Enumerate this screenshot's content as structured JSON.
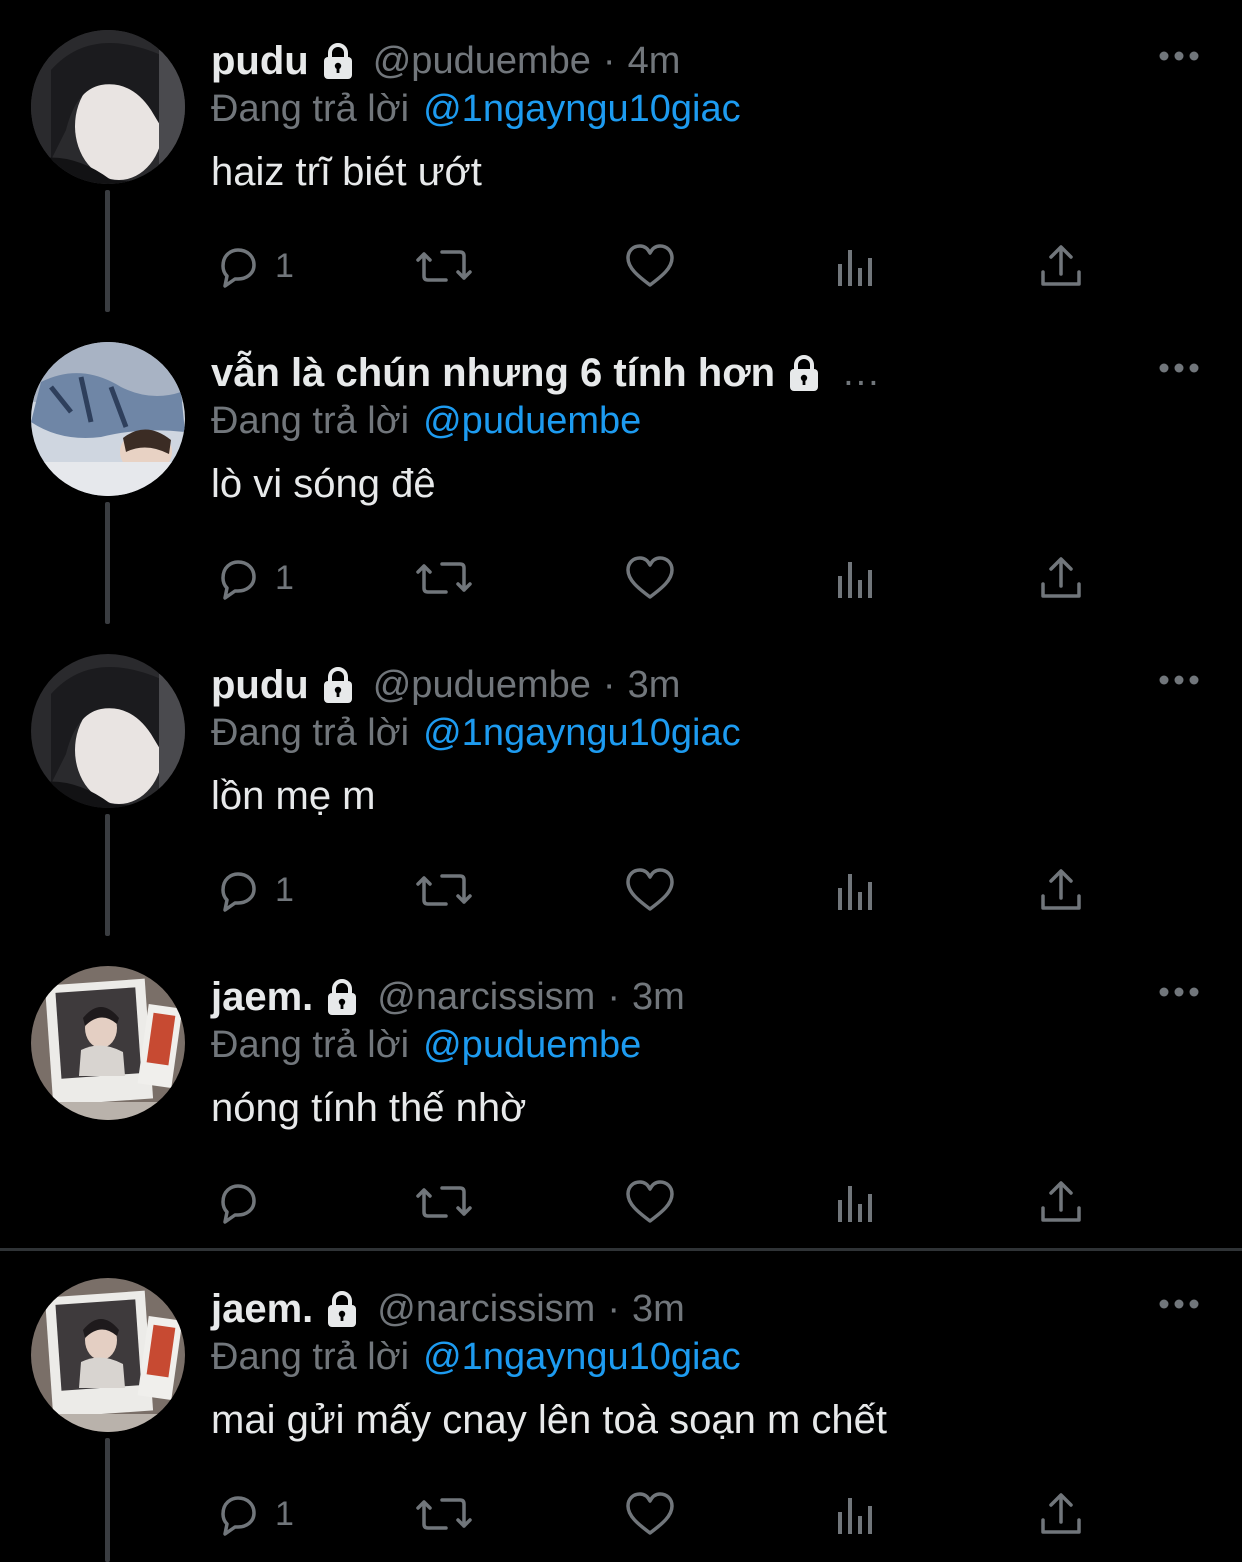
{
  "theme": {
    "background": "#000000",
    "text_primary": "#e7e9ea",
    "text_secondary": "#71767b",
    "accent": "#1d9bf0",
    "thread_line": "#3a3d41"
  },
  "labels": {
    "replying_to_prefix": "Đang trả lời",
    "dot": "·",
    "name_overflow": "..."
  },
  "tweets": [
    {
      "display_name": "pudu",
      "handle": "@puduembe",
      "time": "4m",
      "reply_to": "@1ngayngu10giac",
      "text": "haiz trĩ biét ướt",
      "reply_count": "1",
      "avatar": "avatar-dark-hair-boy"
    },
    {
      "display_name": "vẫn là chún nhưng 6 tính hơn",
      "handle": "",
      "time": "",
      "reply_to": "@puduembe",
      "text": "lò vi sóng đê",
      "reply_count": "1",
      "avatar": "avatar-lying-boy"
    },
    {
      "display_name": "pudu",
      "handle": "@puduembe",
      "time": "3m",
      "reply_to": "@1ngayngu10giac",
      "text": "lồn mẹ m",
      "reply_count": "1",
      "avatar": "avatar-dark-hair-boy"
    },
    {
      "display_name": "jaem.",
      "handle": "@narcissism",
      "time": "3m",
      "reply_to": "@puduembe",
      "text": "nóng tính thế nhờ",
      "reply_count": "",
      "avatar": "avatar-polaroid"
    },
    {
      "display_name": "jaem.",
      "handle": "@narcissism",
      "time": "3m",
      "reply_to": "@1ngayngu10giac",
      "text": "mai gửi mấy cnay lên toà soạn m chết",
      "reply_count": "1",
      "avatar": "avatar-polaroid"
    }
  ],
  "icons": {
    "lock": "lock-icon",
    "more": "more-horizontal-icon",
    "reply": "reply-bubble-icon",
    "retweet": "retweet-icon",
    "like": "heart-icon",
    "views": "analytics-bar-icon",
    "share": "share-upload-icon"
  }
}
